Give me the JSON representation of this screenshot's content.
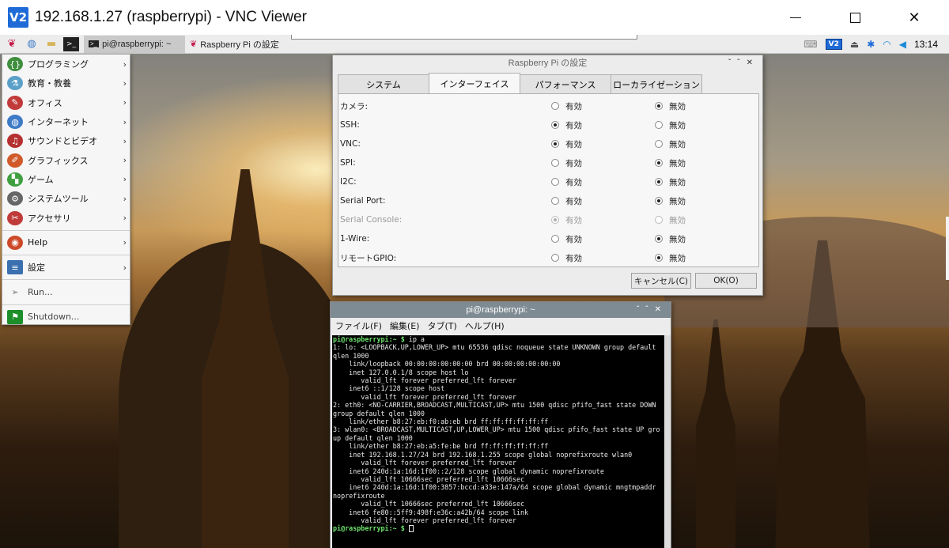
{
  "vnc": {
    "logo": "V2",
    "title": "192.168.1.27 (raspberrypi) - VNC Viewer"
  },
  "taskbar": {
    "tasks": [
      {
        "label": "pi@raspberrypi: ~",
        "icon": "terminal-icon"
      },
      {
        "label": "Raspberry Pi の設定",
        "icon": "raspberry-icon"
      }
    ],
    "clock": "13:14",
    "vnc_tray": "V2"
  },
  "menu": {
    "items": [
      {
        "label": "プログラミング",
        "icon": "programming-icon",
        "color": "#3f8f3f",
        "glyph": "{}"
      },
      {
        "label": "教育・教養",
        "icon": "education-icon",
        "color": "#5aa0c8",
        "glyph": "⚗"
      },
      {
        "label": "オフィス",
        "icon": "office-icon",
        "color": "#c23a3a",
        "glyph": "✎"
      },
      {
        "label": "インターネット",
        "icon": "internet-icon",
        "color": "#3d7ac7",
        "glyph": "◍"
      },
      {
        "label": "サウンドとビデオ",
        "icon": "sound-video-icon",
        "color": "#b53030",
        "glyph": "♫"
      },
      {
        "label": "グラフィックス",
        "icon": "graphics-icon",
        "color": "#d05a2a",
        "glyph": "✐"
      },
      {
        "label": "ゲーム",
        "icon": "game-icon",
        "color": "#3f9f3f",
        "glyph": "▚"
      },
      {
        "label": "システムツール",
        "icon": "system-tools-icon",
        "color": "#666666",
        "glyph": "⚙"
      },
      {
        "label": "アクセサリ",
        "icon": "accessories-icon",
        "color": "#c03a3a",
        "glyph": "✂"
      }
    ],
    "help": {
      "label": "Help",
      "icon": "help-icon",
      "color": "#cc4a2a"
    },
    "settings": {
      "label": "設定",
      "icon": "settings-icon",
      "color": "#3a6fb0"
    },
    "run": {
      "label": "Run...",
      "icon": "run-icon"
    },
    "shutdown": {
      "label": "Shutdown...",
      "icon": "shutdown-icon",
      "color": "#1d8f2a"
    }
  },
  "dialog": {
    "title": "Raspberry Pi の設定",
    "tabs": [
      "システム",
      "インターフェイス",
      "パフォーマンス",
      "ローカライゼーション"
    ],
    "active_tab": "インターフェイス",
    "enable_label": "有効",
    "disable_label": "無効",
    "rows": [
      {
        "label": "カメラ:",
        "value": "無効",
        "disabled": false
      },
      {
        "label": "SSH:",
        "value": "有効",
        "disabled": false
      },
      {
        "label": "VNC:",
        "value": "有効",
        "disabled": false
      },
      {
        "label": "SPI:",
        "value": "無効",
        "disabled": false
      },
      {
        "label": "I2C:",
        "value": "無効",
        "disabled": false
      },
      {
        "label": "Serial Port:",
        "value": "無効",
        "disabled": false
      },
      {
        "label": "Serial Console:",
        "value": "有効",
        "disabled": true
      },
      {
        "label": "1-Wire:",
        "value": "無効",
        "disabled": false
      },
      {
        "label": "リモートGPIO:",
        "value": "無効",
        "disabled": false
      }
    ],
    "cancel_label": "キャンセル(C)",
    "ok_label": "OK(O)"
  },
  "terminal": {
    "title": "pi@raspberrypi: ~",
    "menu": [
      "ファイル(F)",
      "編集(E)",
      "タブ(T)",
      "ヘルプ(H)"
    ],
    "prompt": "pi@raspberrypi:~ $",
    "command": " ip a",
    "output": "1: lo: <LOOPBACK,UP,LOWER_UP> mtu 65536 qdisc noqueue state UNKNOWN group default qlen 1000\n    link/loopback 00:00:00:00:00:00 brd 00:00:00:00:00:00\n    inet 127.0.0.1/8 scope host lo\n       valid_lft forever preferred_lft forever\n    inet6 ::1/128 scope host\n       valid_lft forever preferred_lft forever\n2: eth0: <NO-CARRIER,BROADCAST,MULTICAST,UP> mtu 1500 qdisc pfifo_fast state DOWN group default qlen 1000\n    link/ether b8:27:eb:f0:ab:eb brd ff:ff:ff:ff:ff:ff\n3: wlan0: <BROADCAST,MULTICAST,UP,LOWER_UP> mtu 1500 qdisc pfifo_fast state UP group default qlen 1000\n    link/ether b8:27:eb:a5:fe:be brd ff:ff:ff:ff:ff:ff\n    inet 192.168.1.27/24 brd 192.168.1.255 scope global noprefixroute wlan0\n       valid_lft forever preferred_lft forever\n    inet6 240d:1a:16d:1f00::2/128 scope global dynamic noprefixroute\n       valid_lft 10666sec preferred_lft 10666sec\n    inet6 240d:1a:16d:1f00:3857:bccd:a33e:147a/64 scope global dynamic mngtmpaddr noprefixroute\n       valid_lft 10666sec preferred_lft 10666sec\n    inet6 fe80::5ff9:498f:e36c:a42b/64 scope link\n       valid_lft forever preferred_lft forever",
    "final_prompt": "pi@raspberrypi:~ $"
  }
}
